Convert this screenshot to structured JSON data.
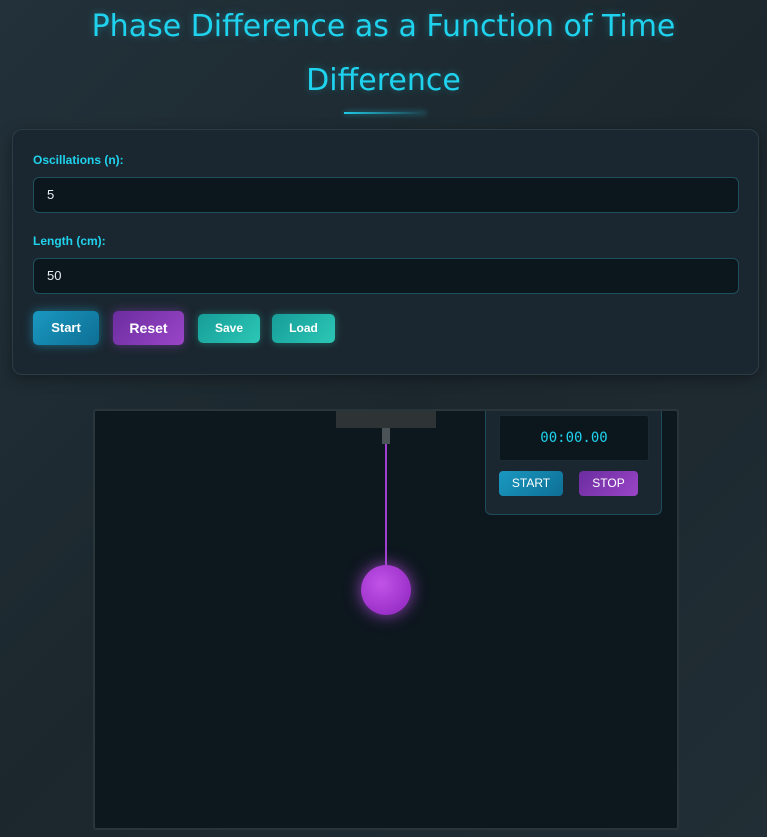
{
  "page": {
    "title_line1": "Phase Difference as a Function of Time",
    "title_line2": "Difference"
  },
  "controls": {
    "oscillations_label": "Oscillations (n):",
    "oscillations_value": "5",
    "length_label": "Length (cm):",
    "length_value": "50",
    "start_label": "Start",
    "reset_label": "Reset",
    "save_label": "Save",
    "load_label": "Load"
  },
  "stopwatch": {
    "display": "00:00.00",
    "start_label": "START",
    "stop_label": "STOP"
  },
  "colors": {
    "accent": "#1fd3ee",
    "bob": "#a83fd6",
    "background": "#1e2a30"
  }
}
